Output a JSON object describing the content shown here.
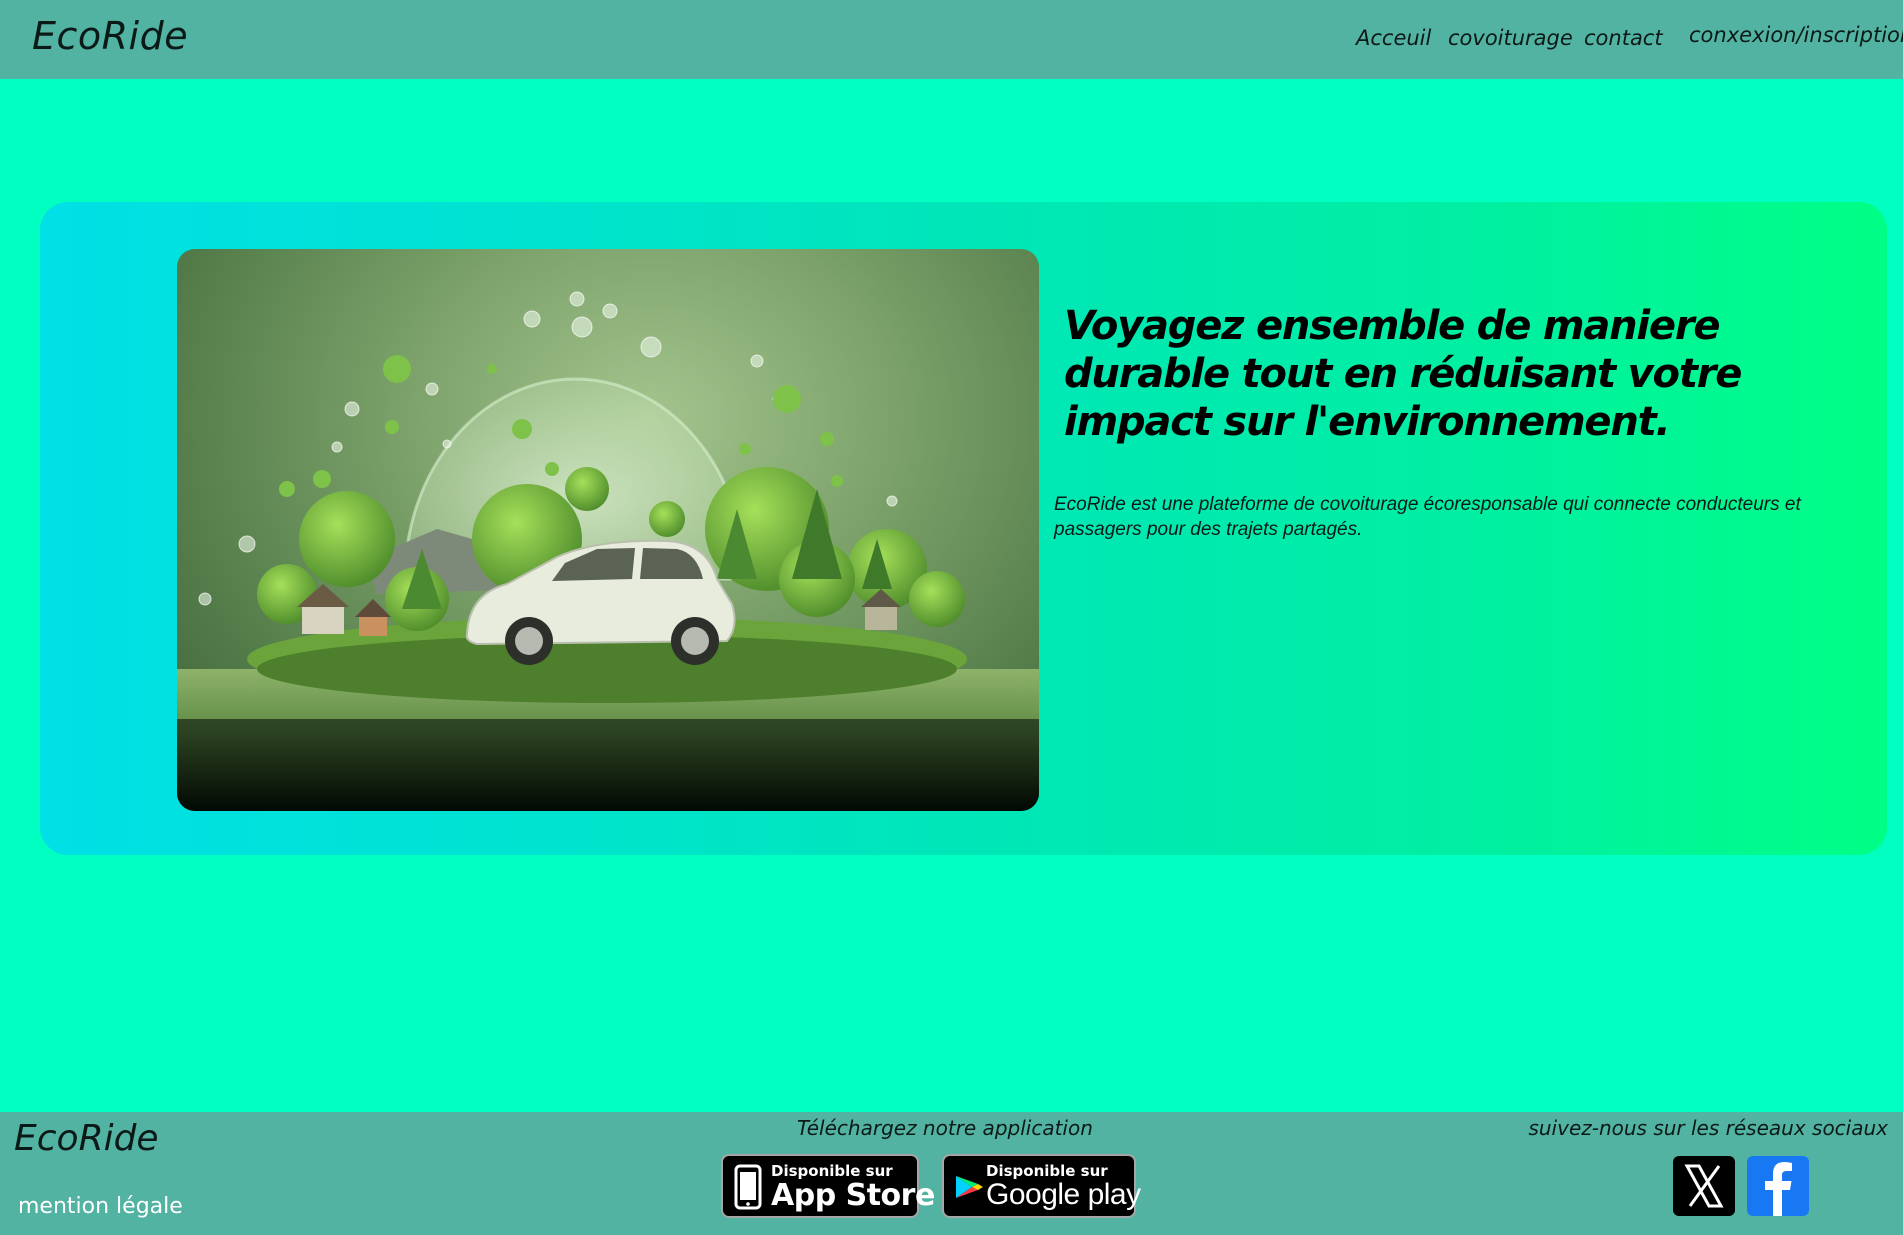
{
  "header": {
    "logo": "EcoRide",
    "nav": {
      "home": "Acceuil",
      "carpool": "covoiturage",
      "contact": "contact",
      "login": "conxexion/inscription"
    }
  },
  "hero": {
    "title": "Voyagez ensemble de maniere durable tout en réduisant votre impact sur l'environnement.",
    "description": "EcoRide est une plateforme de covoiturage écoresponsable qui connecte conducteurs et passagers pour des trajets partagés."
  },
  "footer": {
    "logo": "EcoRide",
    "legal": "mention légale",
    "download_label": "Téléchargez notre application",
    "appstore": {
      "small": "Disponible sur",
      "big": "App Store"
    },
    "googleplay": {
      "small": "Disponible sur",
      "big": "Google play"
    },
    "social_label": "suivez-nous sur les réseaux sociaux"
  },
  "colors": {
    "page_background": "#00ffc0",
    "header_background": "#52b3a3",
    "hero_gradient_start": "#00e0e6",
    "hero_gradient_end": "#00ff85",
    "facebook": "#1877f2"
  },
  "icons": [
    "apple-icon",
    "google-play-icon",
    "x-icon",
    "facebook-icon"
  ]
}
